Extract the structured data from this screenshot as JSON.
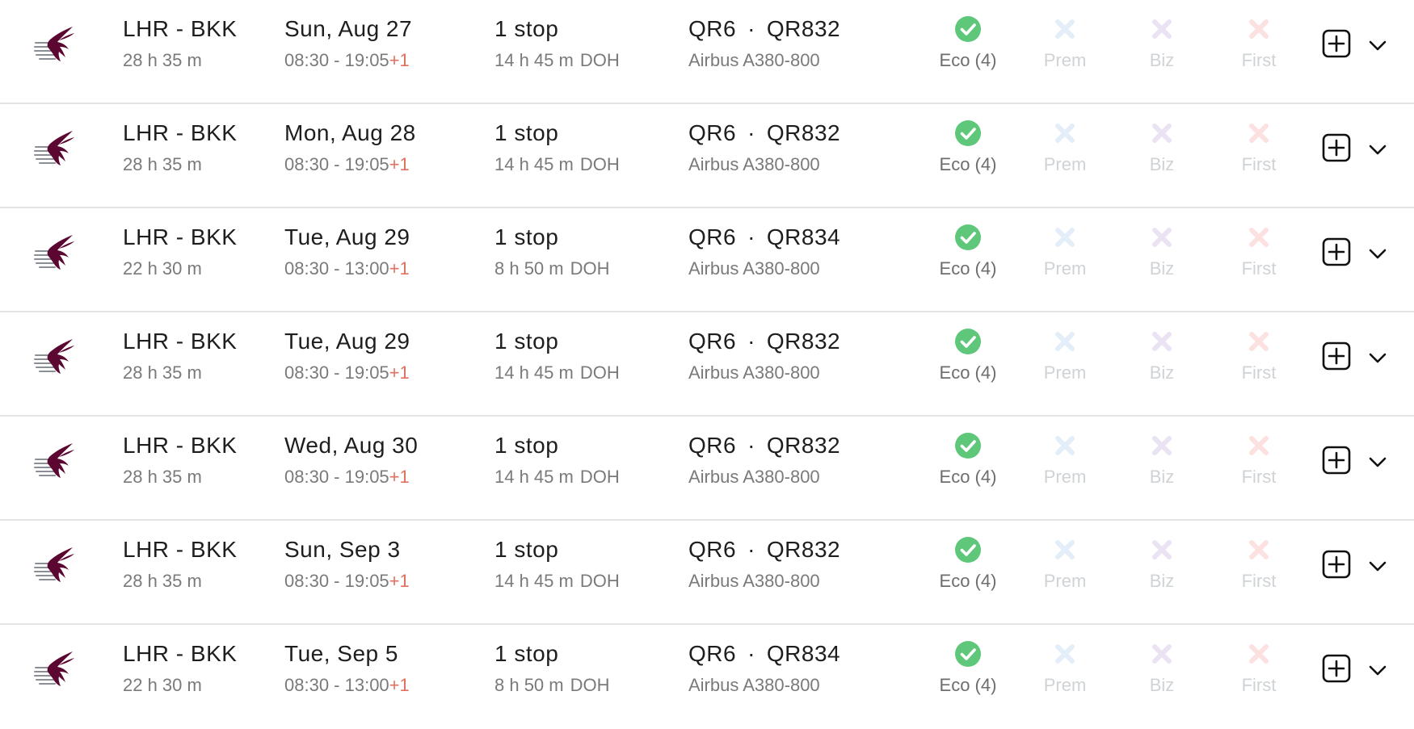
{
  "colors": {
    "airline_brand": "#5c0632",
    "available": "#5fc77a",
    "premium_unavailable": "#e3eef8",
    "business_unavailable": "#ebe2f3",
    "first_unavailable": "#fbe1df",
    "next_day": "#e07060"
  },
  "icons": {
    "airline_logo": "qatar-airways-oryx-logo",
    "available": "check-circle-icon",
    "unavailable": "x-icon",
    "add": "plus-square-icon",
    "expand": "chevron-down-icon"
  },
  "cabin_labels": {
    "prem": "Prem",
    "biz": "Biz",
    "first": "First"
  },
  "flights": [
    {
      "route": "LHR - BKK",
      "total_duration": "28 h 35 m",
      "date": "Sun, Aug 27",
      "times": "08:30 - 19:05",
      "day_offset": "+1",
      "stops": "1 stop",
      "layover": "14 h 45 m",
      "via": "DOH",
      "flight_1": "QR6",
      "separator": "·",
      "flight_2": "QR832",
      "aircraft": "Airbus A380-800",
      "eco_label": "Eco (4)"
    },
    {
      "route": "LHR - BKK",
      "total_duration": "28 h 35 m",
      "date": "Mon, Aug 28",
      "times": "08:30 - 19:05",
      "day_offset": "+1",
      "stops": "1 stop",
      "layover": "14 h 45 m",
      "via": "DOH",
      "flight_1": "QR6",
      "separator": "·",
      "flight_2": "QR832",
      "aircraft": "Airbus A380-800",
      "eco_label": "Eco (4)"
    },
    {
      "route": "LHR - BKK",
      "total_duration": "22 h 30 m",
      "date": "Tue, Aug 29",
      "times": "08:30 - 13:00",
      "day_offset": "+1",
      "stops": "1 stop",
      "layover": "8 h 50 m",
      "via": "DOH",
      "flight_1": "QR6",
      "separator": "·",
      "flight_2": "QR834",
      "aircraft": "Airbus A380-800",
      "eco_label": "Eco (4)"
    },
    {
      "route": "LHR - BKK",
      "total_duration": "28 h 35 m",
      "date": "Tue, Aug 29",
      "times": "08:30 - 19:05",
      "day_offset": "+1",
      "stops": "1 stop",
      "layover": "14 h 45 m",
      "via": "DOH",
      "flight_1": "QR6",
      "separator": "·",
      "flight_2": "QR832",
      "aircraft": "Airbus A380-800",
      "eco_label": "Eco (4)"
    },
    {
      "route": "LHR - BKK",
      "total_duration": "28 h 35 m",
      "date": "Wed, Aug 30",
      "times": "08:30 - 19:05",
      "day_offset": "+1",
      "stops": "1 stop",
      "layover": "14 h 45 m",
      "via": "DOH",
      "flight_1": "QR6",
      "separator": "·",
      "flight_2": "QR832",
      "aircraft": "Airbus A380-800",
      "eco_label": "Eco (4)"
    },
    {
      "route": "LHR - BKK",
      "total_duration": "28 h 35 m",
      "date": "Sun, Sep 3",
      "times": "08:30 - 19:05",
      "day_offset": "+1",
      "stops": "1 stop",
      "layover": "14 h 45 m",
      "via": "DOH",
      "flight_1": "QR6",
      "separator": "·",
      "flight_2": "QR832",
      "aircraft": "Airbus A380-800",
      "eco_label": "Eco (4)"
    },
    {
      "route": "LHR - BKK",
      "total_duration": "22 h 30 m",
      "date": "Tue, Sep 5",
      "times": "08:30 - 13:00",
      "day_offset": "+1",
      "stops": "1 stop",
      "layover": "8 h 50 m",
      "via": "DOH",
      "flight_1": "QR6",
      "separator": "·",
      "flight_2": "QR834",
      "aircraft": "Airbus A380-800",
      "eco_label": "Eco (4)"
    }
  ]
}
